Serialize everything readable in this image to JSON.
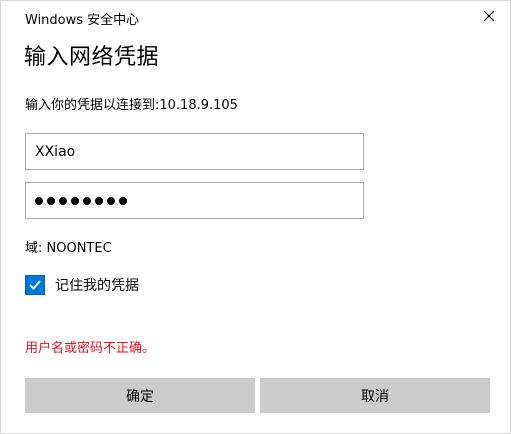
{
  "window": {
    "title": "Windows 安全中心",
    "close_icon": "close-icon"
  },
  "dialog": {
    "heading": "输入网络凭据",
    "prompt": "输入你的凭据以连接到:10.18.9.105",
    "username_value": "XXiao",
    "password_mask": "●●●●●●●●",
    "domain_label": "域: NOONTEC",
    "remember_label": "记住我的凭据",
    "remember_checked": true,
    "error_message": "用户名或密码不正确。"
  },
  "buttons": {
    "ok_label": "确定",
    "cancel_label": "取消"
  },
  "colors": {
    "accent": "#0078d7",
    "error": "#e81123",
    "button_bg": "#cccccc",
    "field_border": "#a8a8a8"
  }
}
